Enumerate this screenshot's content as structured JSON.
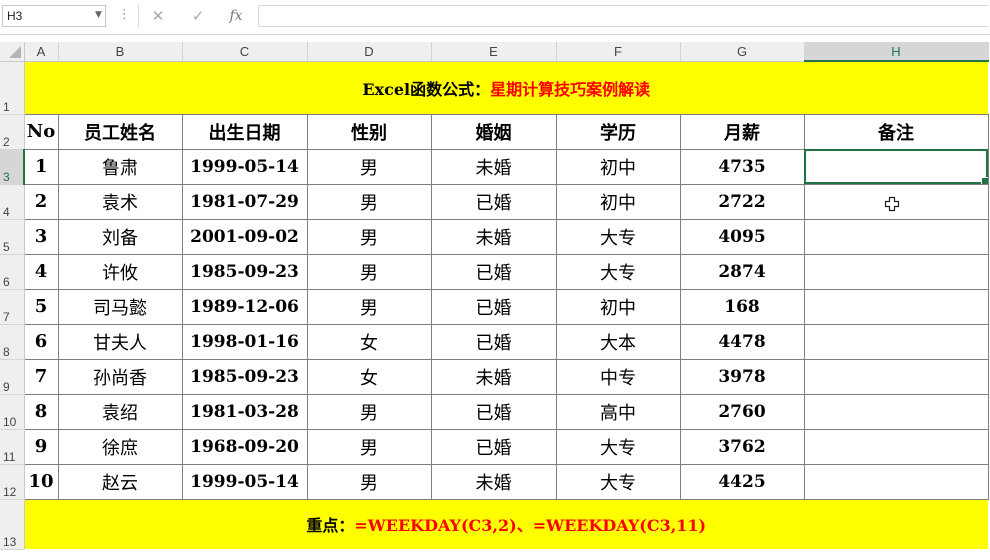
{
  "formula_bar": {
    "name_box": "H3",
    "cancel_icon": "✕",
    "enter_icon": "✓",
    "fx_label": "fx",
    "formula": ""
  },
  "columns": [
    "A",
    "B",
    "C",
    "D",
    "E",
    "F",
    "G",
    "H"
  ],
  "selected_column": "H",
  "rows": [
    "1",
    "2",
    "3",
    "4",
    "5",
    "6",
    "7",
    "8",
    "9",
    "10",
    "11",
    "12",
    "13"
  ],
  "selected_row": "3",
  "title": {
    "prefix": "Excel函数公式：",
    "highlight": "星期计算技巧案例解读"
  },
  "headers": [
    "No",
    "员工姓名",
    "出生日期",
    "性别",
    "婚姻",
    "学历",
    "月薪",
    "备注"
  ],
  "records": [
    {
      "no": "1",
      "name": "鲁肃",
      "birth": "1999-05-14",
      "gender": "男",
      "marital": "未婚",
      "edu": "初中",
      "salary": "4735",
      "note": ""
    },
    {
      "no": "2",
      "name": "袁术",
      "birth": "1981-07-29",
      "gender": "男",
      "marital": "已婚",
      "edu": "初中",
      "salary": "2722",
      "note": ""
    },
    {
      "no": "3",
      "name": "刘备",
      "birth": "2001-09-02",
      "gender": "男",
      "marital": "未婚",
      "edu": "大专",
      "salary": "4095",
      "note": ""
    },
    {
      "no": "4",
      "name": "许攸",
      "birth": "1985-09-23",
      "gender": "男",
      "marital": "已婚",
      "edu": "大专",
      "salary": "2874",
      "note": ""
    },
    {
      "no": "5",
      "name": "司马懿",
      "birth": "1989-12-06",
      "gender": "男",
      "marital": "已婚",
      "edu": "初中",
      "salary": "168",
      "note": ""
    },
    {
      "no": "6",
      "name": "甘夫人",
      "birth": "1998-01-16",
      "gender": "女",
      "marital": "已婚",
      "edu": "大本",
      "salary": "4478",
      "note": ""
    },
    {
      "no": "7",
      "name": "孙尚香",
      "birth": "1985-09-23",
      "gender": "女",
      "marital": "未婚",
      "edu": "中专",
      "salary": "3978",
      "note": ""
    },
    {
      "no": "8",
      "name": "袁绍",
      "birth": "1981-03-28",
      "gender": "男",
      "marital": "已婚",
      "edu": "高中",
      "salary": "2760",
      "note": ""
    },
    {
      "no": "9",
      "name": "徐庶",
      "birth": "1968-09-20",
      "gender": "男",
      "marital": "已婚",
      "edu": "大专",
      "salary": "3762",
      "note": ""
    },
    {
      "no": "10",
      "name": "赵云",
      "birth": "1999-05-14",
      "gender": "男",
      "marital": "未婚",
      "edu": "大专",
      "salary": "4425",
      "note": ""
    }
  ],
  "footer": {
    "prefix": "重点：",
    "formula": "=WEEKDAY(C3,2)、=WEEKDAY(C3,11)"
  },
  "colors": {
    "highlight_fill": "#ffff00",
    "accent_red": "#ff0000",
    "excel_green": "#217346"
  },
  "cursor_icon": "cell-select-cross"
}
